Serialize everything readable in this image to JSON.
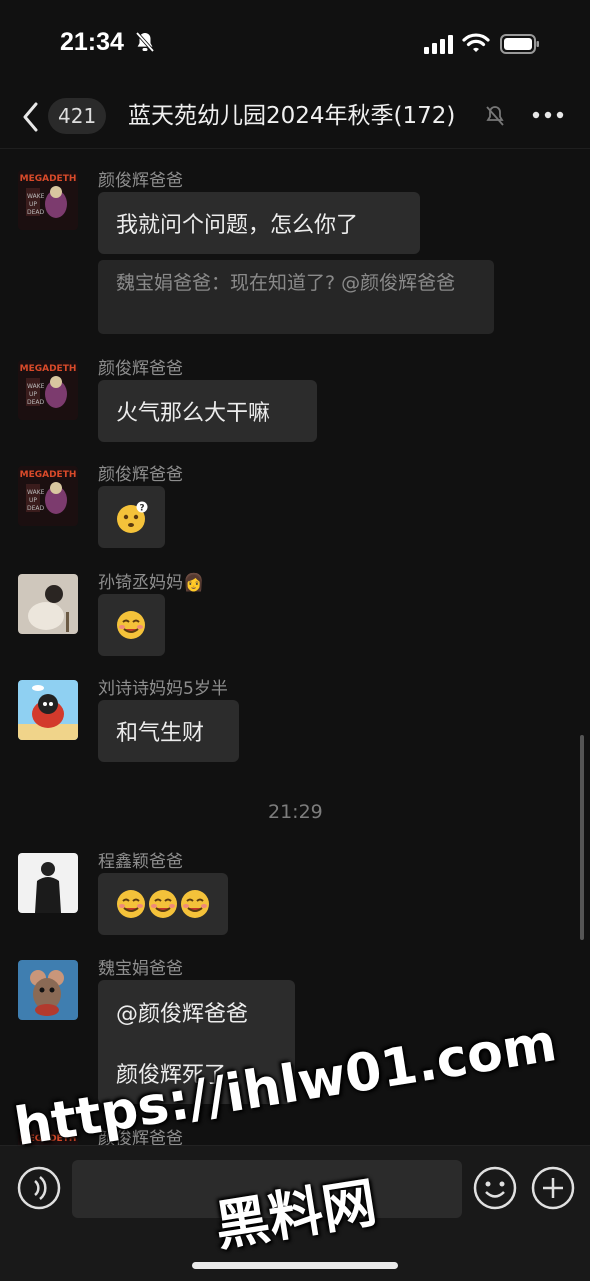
{
  "status_bar": {
    "time": "21:34"
  },
  "nav": {
    "unread_count": "421",
    "title": "蓝天苑幼儿园2024年秋季(172)"
  },
  "messages": [
    {
      "sender": "颜俊辉爸爸",
      "avatar": "megadeth-album-avatar",
      "text": "我就问个问题，怎么你了",
      "quote": "魏宝娟爸爸：现在知道了? @颜俊辉爸爸"
    },
    {
      "sender": "颜俊辉爸爸",
      "avatar": "megadeth-album-avatar",
      "text": "火气那么大干嘛"
    },
    {
      "sender": "颜俊辉爸爸",
      "avatar": "megadeth-album-avatar",
      "emoji": "confused-face"
    },
    {
      "sender": "孙锜丞妈妈",
      "sender_emoji": "👩",
      "avatar": "photo-avatar",
      "emoji": "sly-smile-face"
    },
    {
      "sender": "刘诗诗妈妈5岁半",
      "avatar": "cartoon-avatar",
      "text": "和气生财"
    },
    {
      "sender": "程鑫颖爸爸",
      "avatar": "person-photo-avatar",
      "emoji": "sly-smile-face x3"
    },
    {
      "sender": "魏宝娟爸爸",
      "avatar": "mouse-avatar",
      "text_line1": "@颜俊辉爸爸",
      "text_line2": "颜俊辉死了"
    },
    {
      "sender": "颜俊辉爸爸",
      "avatar": "megadeth-album-avatar"
    }
  ],
  "timestamp": "21:29",
  "input": {
    "placeholder": ""
  },
  "watermark": {
    "url": "https://ihlw01.com",
    "name": "黑料网"
  },
  "colors": {
    "background": "#111111",
    "bubble": "#2c2c2c",
    "sender": "#8e8e8e"
  }
}
